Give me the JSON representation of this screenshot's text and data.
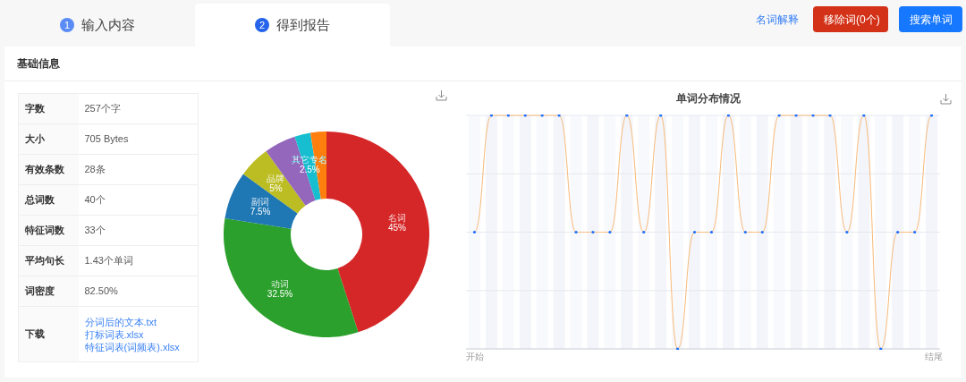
{
  "tabs": [
    {
      "number": "1",
      "label": "输入内容",
      "selected": false
    },
    {
      "number": "2",
      "label": "得到报告",
      "selected": true
    }
  ],
  "actions": {
    "link": "名词解释",
    "remove_button": "移除词(0个)",
    "search_button": "搜索单词"
  },
  "section": {
    "title": "基础信息"
  },
  "info_table": [
    {
      "label": "字数",
      "value": "257个字"
    },
    {
      "label": "大小",
      "value": "705 Bytes"
    },
    {
      "label": "有效条数",
      "value": "28条"
    },
    {
      "label": "总词数",
      "value": "40个"
    },
    {
      "label": "特征词数",
      "value": "33个"
    },
    {
      "label": "平均句长",
      "value": "1.43个单词"
    },
    {
      "label": "词密度",
      "value": "82.50%"
    }
  ],
  "downloads": {
    "label": "下载",
    "links": [
      "分词后的文本.txt",
      "打标词表.xlsx",
      "特征词表(词频表).xlsx"
    ]
  },
  "pie": {
    "chart_data": {
      "type": "donut",
      "categories": [
        "名词",
        "动词",
        "副词",
        "品牌",
        null,
        "其它专名",
        null
      ],
      "values": [
        45,
        32.5,
        7.5,
        5,
        5,
        2.5,
        2.5
      ],
      "colors": [
        "#d62728",
        "#2ca02c",
        "#1f77b4",
        "#bcbd22",
        "#9467bd",
        "#17becf",
        "#ff7f0e"
      ],
      "value_labels": [
        "45%",
        "32.5%",
        "7.5%",
        "5%",
        null,
        "2.5%",
        null
      ]
    }
  },
  "distribution": {
    "title": "单词分布情况",
    "start_label": "开始",
    "end_label": "结尾"
  }
}
